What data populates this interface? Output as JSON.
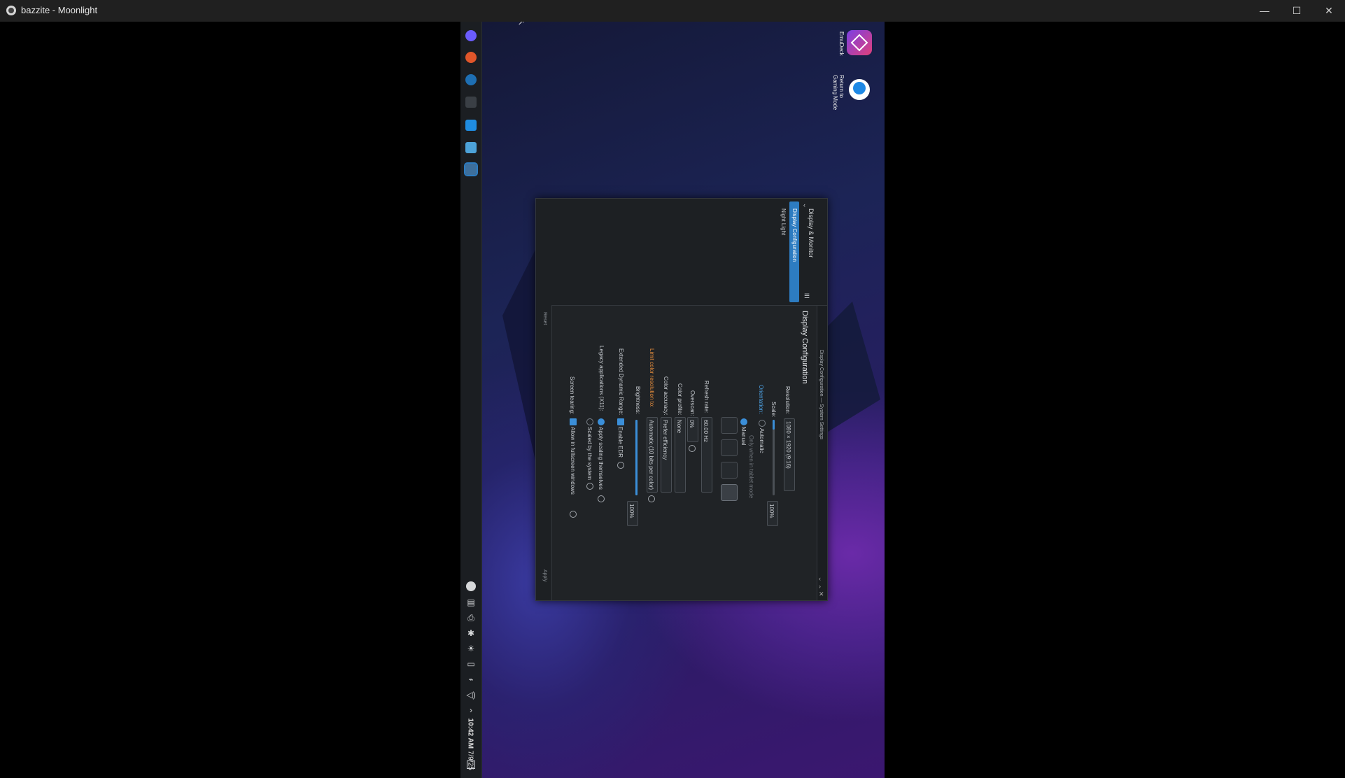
{
  "window": {
    "title": "bazzite - Moonlight",
    "controls": {
      "minimize": "—",
      "maximize": "☐",
      "close": "✕"
    }
  },
  "desktop": {
    "icons": [
      {
        "label": "EmuDeck",
        "icon": "emudeck-icon"
      },
      {
        "label": "Return to Gaming Mode",
        "icon": "return-gaming-mode-icon"
      }
    ]
  },
  "taskbar": {
    "apps": [
      {
        "icon": "app-launcher-icon",
        "color": "#6b5cff"
      },
      {
        "icon": "firefox-icon",
        "color": "#e0562a"
      },
      {
        "icon": "steam-icon",
        "color": "#1e6fb3"
      },
      {
        "icon": "terminal-icon",
        "color": "#3a3f45"
      },
      {
        "icon": "discover-icon",
        "color": "#1f8ce0"
      },
      {
        "icon": "file-manager-icon",
        "color": "#4da3d9"
      },
      {
        "icon": "system-settings-icon",
        "color": "#3d6f9c"
      }
    ],
    "tray": [
      "steam-tray-icon",
      "clipboard-icon",
      "printer-icon",
      "bluetooth-icon",
      "brightness-icon",
      "display-icon",
      "network-icon",
      "volume-icon",
      "expand-tray-icon"
    ],
    "clock": {
      "time": "10:42 AM",
      "date": "7/9/25"
    }
  },
  "settings": {
    "titlebar": "Display Configuration — System Settings",
    "nav": {
      "back_label": "Display & Monitor",
      "items": [
        "Display Configuration",
        "Night Light"
      ]
    },
    "page_title": "Display Configuration",
    "resolution": {
      "label": "Resolution:",
      "value": "1080 × 1920 (9:16)"
    },
    "scale": {
      "label": "Scale:",
      "value": "100%"
    },
    "orientation": {
      "label": "Orientation:",
      "automatic": "Automatic",
      "tablet_note": "Only when in tablet mode",
      "manual": "Manual"
    },
    "refresh_rate": {
      "label": "Refresh rate:",
      "value": "60.00 Hz"
    },
    "overscan": {
      "label": "Overscan:",
      "value": "0%"
    },
    "color_profile": {
      "label": "Color profile:",
      "value": "None"
    },
    "color_accuracy": {
      "label": "Color accuracy:",
      "value": "Prefer efficiency"
    },
    "limit_color": {
      "label": "Limit color resolution to:",
      "value": "Automatic (10 bits per color)"
    },
    "brightness": {
      "label": "Brightness:",
      "value": "100%",
      "level": 1.0
    },
    "edr": {
      "label": "Extended Dynamic Range:",
      "option": "Enable EDR"
    },
    "legacy": {
      "label": "Legacy applications (X11):",
      "option1": "Apply scaling themselves",
      "option2": "Scaled by the system"
    },
    "tearing": {
      "label": "Screen tearing:",
      "option": "Allow in fullscreen windows"
    },
    "reset_label": "Reset",
    "apply_label": "Apply"
  }
}
